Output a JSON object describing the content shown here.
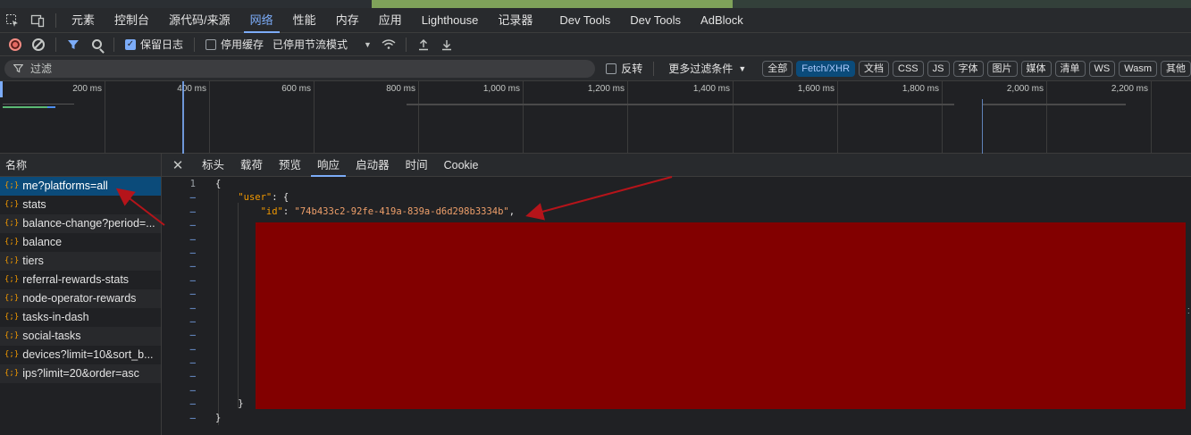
{
  "main_tabs": [
    "元素",
    "控制台",
    "源代码/来源",
    "网络",
    "性能",
    "内存",
    "应用",
    "Lighthouse",
    "记录器",
    "Dev Tools",
    "Dev Tools",
    "AdBlock"
  ],
  "active_main_tab": "网络",
  "toolbar": {
    "preserve_log": "保留日志",
    "preserve_log_checked": true,
    "disable_cache": "停用缓存",
    "disable_cache_checked": false,
    "throttling": "已停用节流模式"
  },
  "filterbar": {
    "placeholder": "过滤",
    "invert": "反转",
    "more_filters": "更多过滤条件",
    "chips": [
      "全部",
      "Fetch/XHR",
      "文档",
      "CSS",
      "JS",
      "字体",
      "图片",
      "媒体",
      "清单",
      "WS",
      "Wasm",
      "其他"
    ],
    "active_chip": "Fetch/XHR"
  },
  "overview": {
    "ticks": [
      "200 ms",
      "400 ms",
      "600 ms",
      "800 ms",
      "1,000 ms",
      "1,200 ms",
      "1,400 ms",
      "1,600 ms",
      "1,800 ms",
      "2,000 ms",
      "2,200 ms"
    ]
  },
  "request_list": {
    "header": "名称",
    "items": [
      "me?platforms=all",
      "stats",
      "balance-change?period=...",
      "balance",
      "tiers",
      "referral-rewards-stats",
      "node-operator-rewards",
      "tasks-in-dash",
      "social-tasks",
      "devices?limit=10&sort_b...",
      "ips?limit=20&order=asc"
    ],
    "selected_index": 0
  },
  "detail": {
    "tabs": [
      "标头",
      "载荷",
      "预览",
      "响应",
      "启动器",
      "时间",
      "Cookie"
    ],
    "active_tab": "响应",
    "line_numbers": [
      "1",
      "–",
      "–",
      "–",
      "–",
      "–",
      "–",
      "–",
      "–",
      "–",
      "–",
      "–",
      "–",
      "–",
      "–",
      "–",
      "–",
      "–"
    ],
    "code": {
      "open_brace": "{",
      "user_key": "\"user\"",
      "user_sep": ": {",
      "id_key": "\"id\"",
      "id_sep": ": ",
      "id_value": "\"74b433c2-92fe-419a-839a-d6d298b3334b\"",
      "id_comma": ",",
      "close_inner": "}",
      "close_outer": "}"
    }
  },
  "colors": {
    "accent": "#7cacf8",
    "redaction": "#820000",
    "annotation_arrow": "#b5141a"
  }
}
